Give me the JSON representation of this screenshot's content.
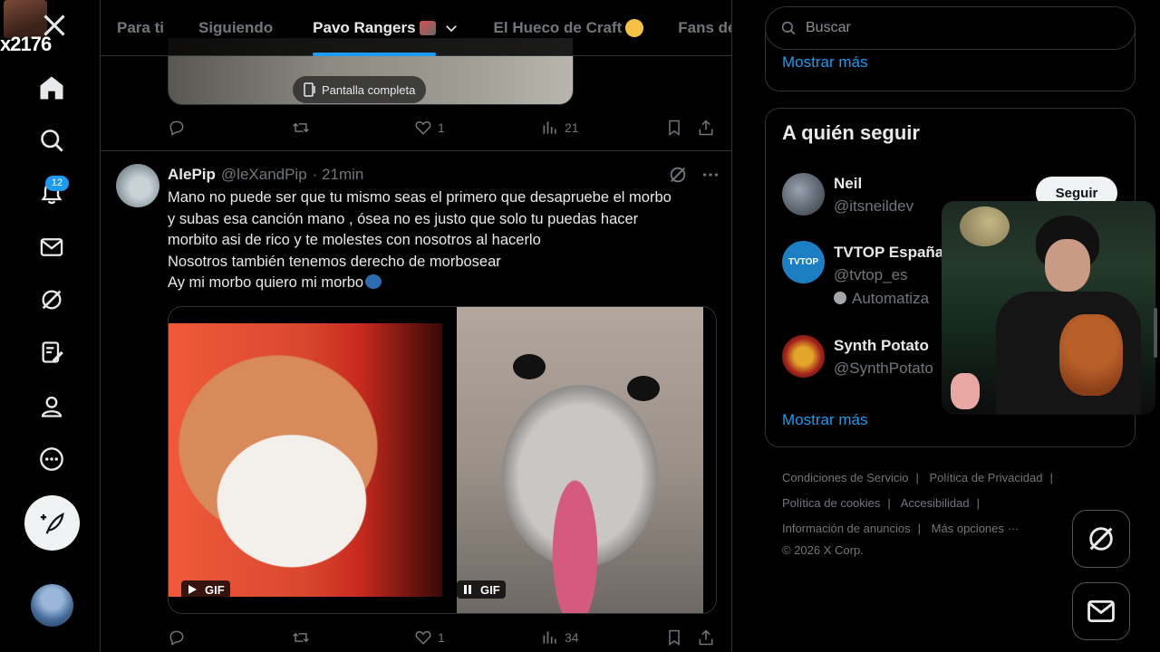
{
  "stream_overlay": {
    "count": "x2176"
  },
  "nav": {
    "notifications_count": "12"
  },
  "tabs": [
    {
      "label": "Para ti"
    },
    {
      "label": "Siguiendo"
    },
    {
      "label": "Pavo Rangers"
    },
    {
      "label": "El Hueco de Craft"
    },
    {
      "label": "Fans de"
    }
  ],
  "previous_post": {
    "fullscreen_label": "Pantalla completa",
    "actions": {
      "replies": "",
      "reposts": "",
      "likes": "1",
      "views": "21"
    }
  },
  "post": {
    "name": "AlePip",
    "handle": "@leXandPip",
    "time": "· 21min",
    "lines": [
      "Mano no puede ser que tu mismo seas el primero que desapruebe el morbo",
      "y subas esa canción mano , ósea no es justo que solo tu puedas hacer",
      "morbito asi de rico y te molestes con nosotros al hacerlo",
      "Nosotros también tenemos derecho de morbosear",
      "Ay mi morbo quiero mi morbo"
    ],
    "gif_label_1": "GIF",
    "gif_label_2": "GIF",
    "actions": {
      "likes": "1",
      "views": "34"
    }
  },
  "sidebar": {
    "search_placeholder": "Buscar",
    "show_more_top": "Mostrar más",
    "who_to_follow_title": "A quién seguir",
    "suggestions": [
      {
        "name": "Neil",
        "handle": "@itsneildev",
        "extra": ""
      },
      {
        "name": "TVTOP España",
        "handle": "@tvtop_es",
        "extra": "Automatiza",
        "avatar_text": "TVTOP"
      },
      {
        "name": "Synth Potato",
        "handle": "@SynthPotato",
        "extra": ""
      }
    ],
    "follow_label": "Seguir",
    "show_more_bottom": "Mostrar más",
    "footer": {
      "terms": "Condiciones de Servicio",
      "privacy": "Política de Privacidad",
      "cookies": "Política de cookies",
      "accessibility": "Accesibilidad",
      "ads": "Información de anuncios",
      "more": "Más opciones ···",
      "copyright": "© 2026 X Corp."
    }
  },
  "colors": {
    "accent": "#1d9bf0",
    "background": "#000000",
    "border": "#2f3336",
    "muted_text": "#71767b",
    "text": "#e7e9ea"
  }
}
